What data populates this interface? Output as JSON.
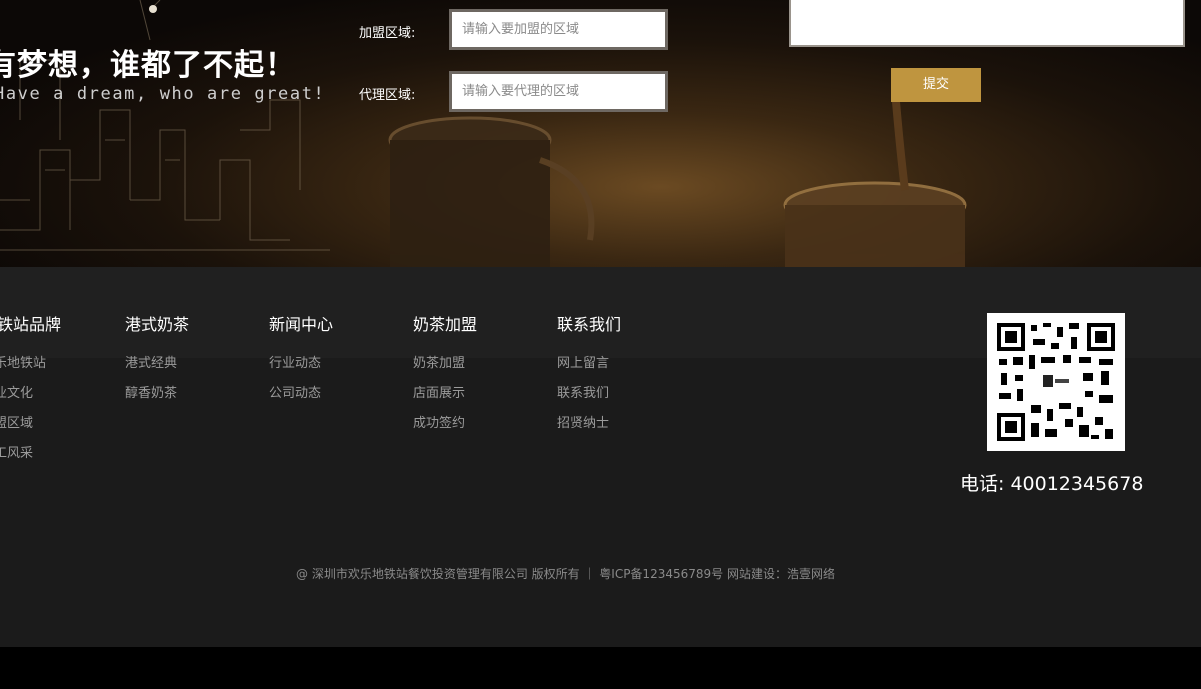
{
  "hero": {
    "slogan_cn": "有梦想，谁都了不起！",
    "slogan_en": "Have a dream, who are great!",
    "form": {
      "join_label": "加盟区域:",
      "join_placeholder": "请输入要加盟的区域",
      "agent_label": "代理区域:",
      "agent_placeholder": "请输入要代理的区域",
      "submit_label": "提交"
    }
  },
  "footer": {
    "nav": [
      {
        "title": "地铁站品牌",
        "links": [
          "欢乐地铁站",
          "企业文化",
          "加盟区域",
          "员工风采"
        ]
      },
      {
        "title": "港式奶茶",
        "links": [
          "港式经典",
          "醇香奶茶"
        ]
      },
      {
        "title": "新闻中心",
        "links": [
          "行业动态",
          "公司动态"
        ]
      },
      {
        "title": "奶茶加盟",
        "links": [
          "奶茶加盟",
          "店面展示",
          "成功签约"
        ]
      },
      {
        "title": "联系我们",
        "links": [
          "网上留言",
          "联系我们",
          "招贤纳士"
        ]
      }
    ],
    "phone": "电话: 40012345678",
    "copyright": "@ 深圳市欢乐地铁站餐饮投资管理有限公司 版权所有 ｜ 粤ICP备123456789号 网站建设：浩壹网络"
  },
  "colors": {
    "accent": "#bf953f",
    "footer_bg": "#1b1b1b",
    "footer_band": "#202020",
    "link": "#9b9b9b"
  }
}
